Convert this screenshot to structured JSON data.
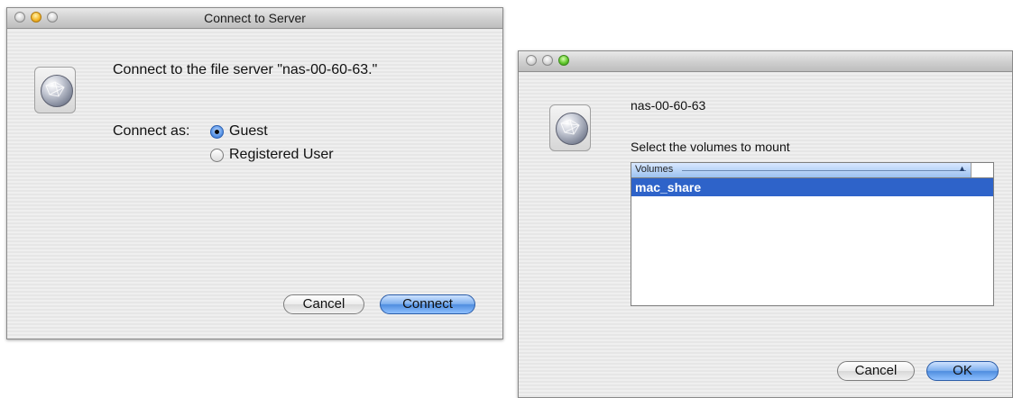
{
  "window1": {
    "title": "Connect to Server",
    "message": "Connect to the file server \"nas-00-60-63.\"",
    "connect_as_label": "Connect as:",
    "options": [
      {
        "label": "Guest",
        "selected": true
      },
      {
        "label": "Registered User",
        "selected": false
      }
    ],
    "cancel_label": "Cancel",
    "connect_label": "Connect"
  },
  "window2": {
    "server_name": "nas-00-60-63",
    "instruction": "Select the volumes to mount",
    "table": {
      "header": "Volumes",
      "rows": [
        "mac_share"
      ]
    },
    "cancel_label": "Cancel",
    "ok_label": "OK"
  },
  "icons": {
    "window_controls": [
      "close-icon",
      "minimize-icon",
      "zoom-icon"
    ],
    "server": "network-server-globe-icon",
    "sort": "sort-ascending-icon"
  },
  "colors": {
    "default_button": "#6fa6ee",
    "selection": "#2e63c9",
    "close_light": "#d0d0d0",
    "minimize_light": "#f4b82b",
    "zoom_light": "#63c92e"
  }
}
